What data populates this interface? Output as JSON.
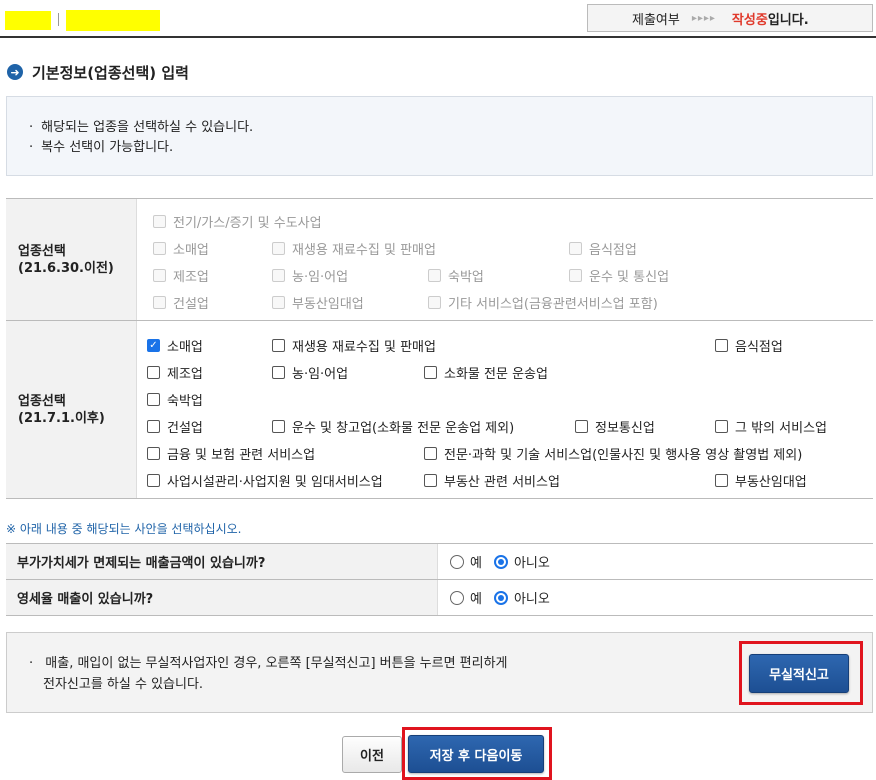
{
  "header": {
    "status_label": "제출여부",
    "status_arrows": "▸▸▸▸",
    "status_value": "작성중",
    "status_suffix": "입니다."
  },
  "section": {
    "title": "기본정보(업종선택) 입력"
  },
  "info": {
    "lines": [
      "해당되는 업종을 선택하실 수 있습니다.",
      "복수 선택이 가능합니다."
    ]
  },
  "old_industry": {
    "label_line1": "업종선택",
    "label_line2": "(21.6.30.이전)",
    "items": [
      "전기/가스/증기 및 수도사업",
      "소매업",
      "재생용 재료수집 및 판매업",
      "음식점업",
      "제조업",
      "농·임·어업",
      "숙박업",
      "운수 및 통신업",
      "건설업",
      "부동산임대업",
      "기타 서비스업(금융관련서비스업 포함)"
    ]
  },
  "new_industry": {
    "label_line1": "업종선택",
    "label_line2": "(21.7.1.이후)",
    "items": [
      "소매업",
      "재생용 재료수집 및 판매업",
      "음식점업",
      "제조업",
      "농·임·어업",
      "소화물 전문 운송업",
      "숙박업",
      "건설업",
      "운수 및 창고업(소화물 전문 운송업 제외)",
      "정보통신업",
      "그 밖의 서비스업",
      "금융 및 보험 관련 서비스업",
      "전문·과학 및 기술 서비스업(인물사진 및 행사용 영상 촬영법 제외)",
      "사업시설관리·사업지원 및 임대서비스업",
      "부동산 관련 서비스업",
      "부동산임대업"
    ],
    "checked": "소매업"
  },
  "note": "※ 아래 내용 중 해당되는 사안을 선택하십시오.",
  "questions": [
    {
      "label": "부가가치세가 면제되는 매출금액이 있습니까?",
      "yes": "예",
      "no": "아니오",
      "selected": "아니오"
    },
    {
      "label": "영세율 매출이 있습니까?",
      "yes": "예",
      "no": "아니오",
      "selected": "아니오"
    }
  ],
  "nil_report": {
    "line1": "매출, 매입이 없는 무실적사업자인 경우, 오른쪽 [무실적신고] 버튼을 누르면 편리하게",
    "line2": "전자신고를 하실 수 있습니다.",
    "button": "무실적신고"
  },
  "footer": {
    "prev": "이전",
    "next": "저장 후 다음이동"
  },
  "colors": {
    "highlight": "#ffff00",
    "accent_blue": "#1f63a8",
    "alert_red": "#e0141e",
    "status_red": "#e0392b"
  }
}
